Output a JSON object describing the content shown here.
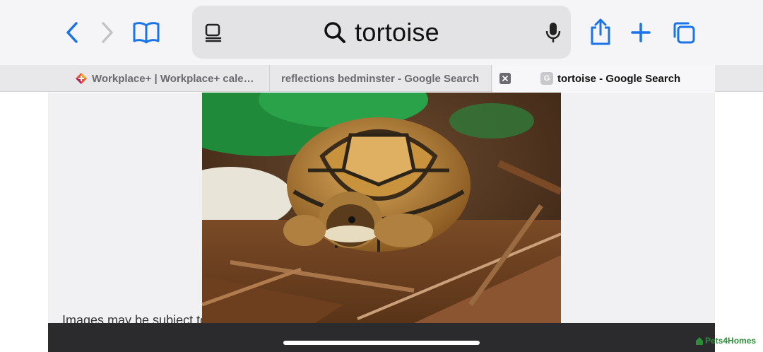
{
  "toolbar": {
    "search_query": "tortoise",
    "icons": {
      "back": "chevron-left-icon",
      "forward": "chevron-right-icon",
      "bookmarks": "book-icon",
      "reader": "reader-icon",
      "search": "magnifier-icon",
      "mic": "microphone-icon",
      "share": "share-icon",
      "new_tab": "plus-icon",
      "tabs": "tabs-icon"
    },
    "accent_color": "#1a73e8"
  },
  "tabs": [
    {
      "label": "Workplace+ | Workplace+ cale…",
      "active": false
    },
    {
      "label": "reflections bedminster - Google Search",
      "active": false
    },
    {
      "label": "tortoise - Google Search",
      "active": true,
      "favicon_letter": "G"
    }
  ],
  "content": {
    "caption": "Images may be subject to copyright. Learn More",
    "watermark": "Pets4Homes"
  }
}
